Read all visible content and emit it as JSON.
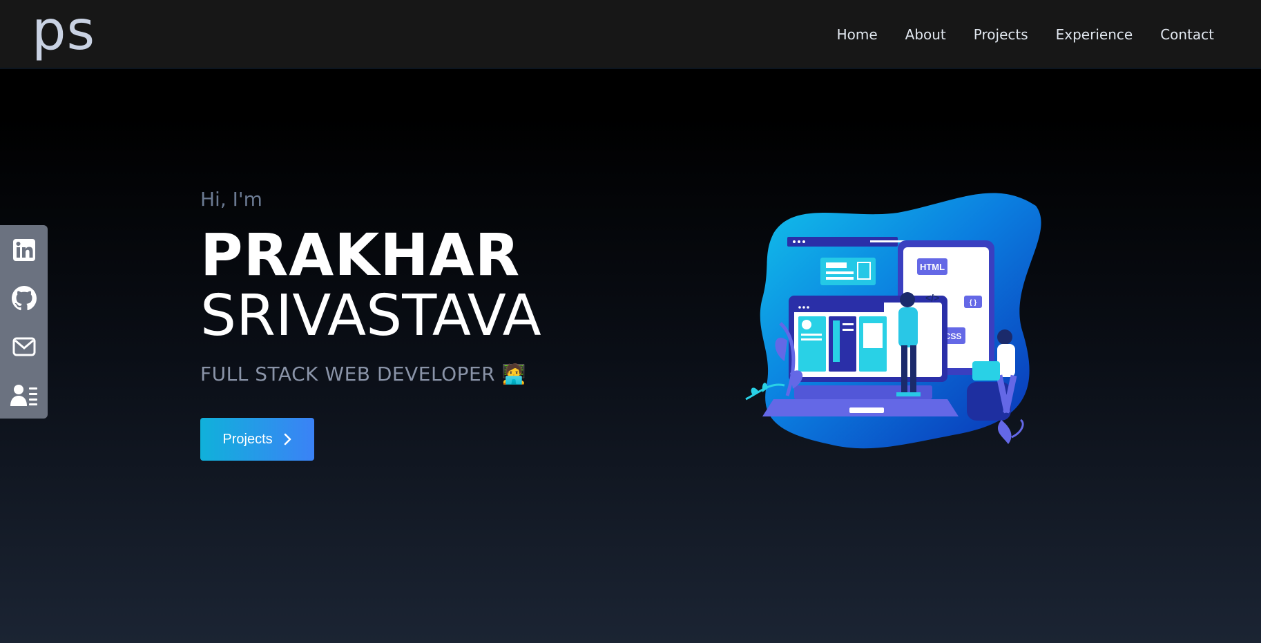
{
  "logo": {
    "text": "ps"
  },
  "nav": {
    "items": [
      {
        "label": "Home"
      },
      {
        "label": "About"
      },
      {
        "label": "Projects"
      },
      {
        "label": "Experience"
      },
      {
        "label": "Contact"
      }
    ]
  },
  "social": {
    "items": [
      {
        "icon": "linkedin-icon"
      },
      {
        "icon": "github-icon"
      },
      {
        "icon": "mail-icon"
      },
      {
        "icon": "resume-icon"
      }
    ]
  },
  "hero": {
    "greeting": "Hi, I'm",
    "first_name": "PRAKHAR",
    "last_name": "SRIVASTAVA",
    "role": "FULL STACK WEB DEVELOPER",
    "role_emoji": "🧑‍💻",
    "cta_label": "Projects"
  },
  "illustration": {
    "html_tag": "HTML",
    "css_tag": "CSS",
    "braces": "{ }",
    "code_tag": "</>"
  },
  "colors": {
    "accent_start": "#10b1da",
    "accent_end": "#3b82f6",
    "navbar_bg": "#171717",
    "social_bar_bg": "#6b7280"
  }
}
